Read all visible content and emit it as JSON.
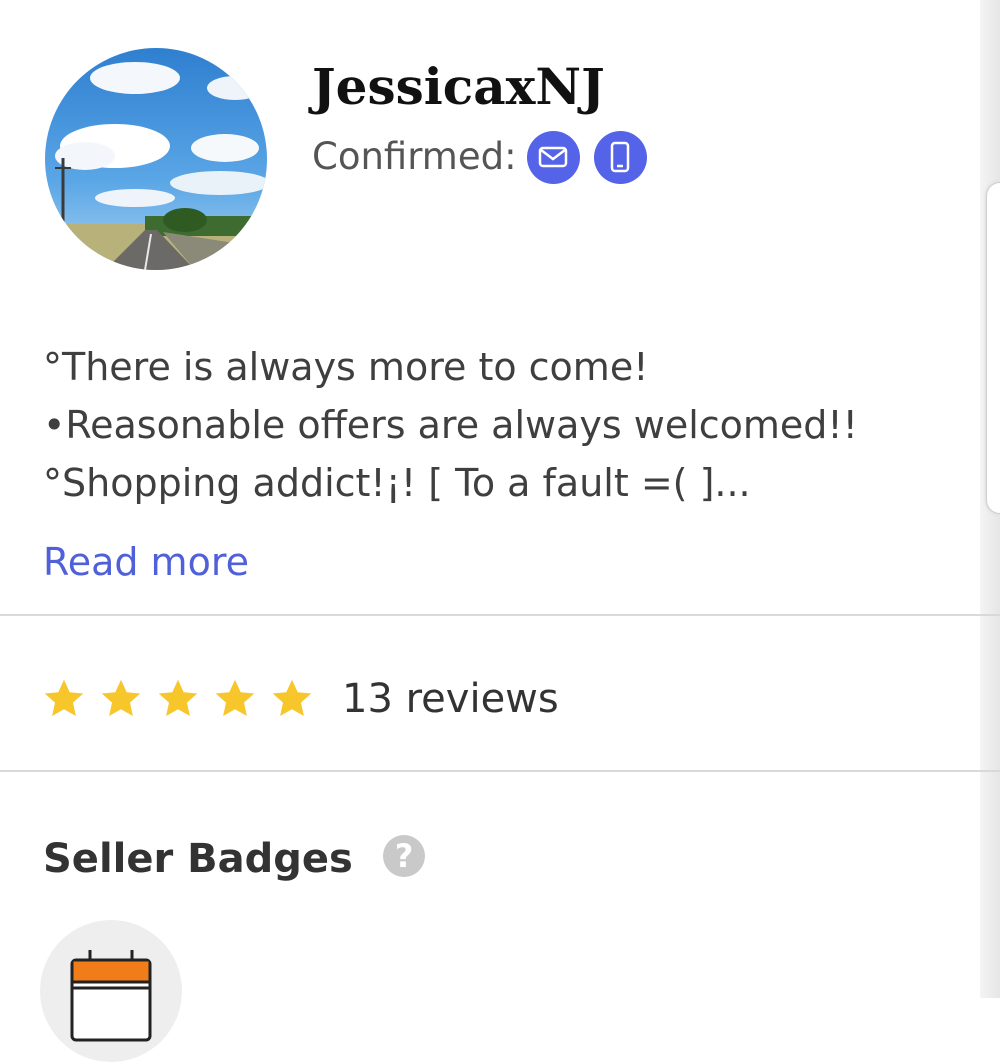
{
  "profile": {
    "username": "JessicaxNJ",
    "confirmed_label": "Confirmed:",
    "confirmed_icons": [
      "email-icon",
      "phone-icon"
    ],
    "accent_color": "#5563e8"
  },
  "bio": {
    "lines": [
      "°There is always more to come!",
      "•Reasonable offers are always welcomed!!",
      "°Shopping addict!¡! [ To a fault =(  ]..."
    ],
    "read_more_label": "Read more",
    "link_color": "#4f60d8"
  },
  "ratings": {
    "stars_filled": 5,
    "stars_total": 5,
    "reviews_label": "13 reviews",
    "star_color": "#f6c62b"
  },
  "badges": {
    "title": "Seller Badges",
    "help_symbol": "?",
    "items": [
      "calendar-icon"
    ]
  }
}
